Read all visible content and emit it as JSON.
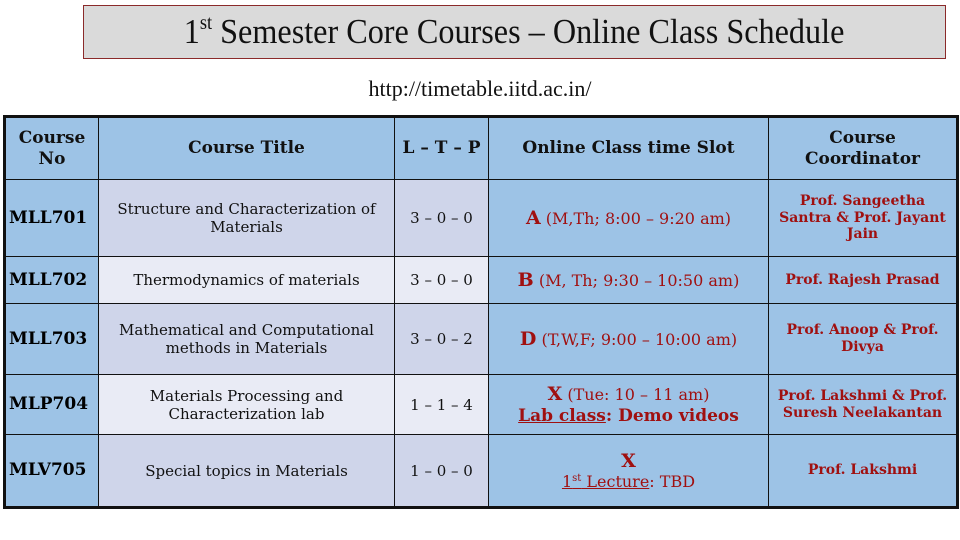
{
  "header": {
    "title_prefix": "1",
    "title_sup": "st",
    "title_main": " Semester Core Courses – Online Class Schedule",
    "url": "http://timetable.iitd.ac.in/"
  },
  "table": {
    "columns": [
      "Course No",
      "Course Title",
      "L – T – P",
      "Online Class time Slot",
      "Course Coordinator"
    ],
    "rows": [
      {
        "course_no": "MLL701",
        "title": "Structure and Characterization of Materials",
        "ltp": "3 – 0 – 0",
        "slot_letter": "A",
        "slot_detail": " (M,Th; 8:00 – 9:20 am)",
        "coordinator": "Prof. Sangeetha Santra & Prof. Jayant Jain"
      },
      {
        "course_no": "MLL702",
        "title": "Thermodynamics of materials",
        "ltp": "3 – 0 – 0",
        "slot_letter": "B",
        "slot_detail": " (M, Th; 9:30 – 10:50 am)",
        "coordinator": "Prof. Rajesh Prasad"
      },
      {
        "course_no": "MLL703",
        "title": "Mathematical and Computational methods in Materials",
        "ltp": "3 – 0 – 2",
        "slot_letter": "D",
        "slot_detail": " (T,W,F; 9:00 – 10:00 am)",
        "coordinator": "Prof. Anoop & Prof. Divya"
      },
      {
        "course_no": "MLP704",
        "title": "Materials Processing and Characterization lab",
        "ltp": "1 – 1 – 4",
        "slot_letter": "X",
        "slot_detail": " (Tue: 10 – 11 am)",
        "slot_note_label": "Lab class",
        "slot_note_sep": ": ",
        "slot_note_value": "Demo videos",
        "coordinator": "Prof. Lakshmi & Prof. Suresh Neelakantan"
      },
      {
        "course_no": "MLV705",
        "title": "Special topics in Materials",
        "ltp": "1 – 0 – 0",
        "slot_letter": "X",
        "slot_note_num": "1",
        "slot_note_sup": "st",
        "slot_note_label": " Lecture",
        "slot_note_sep": ": ",
        "slot_note_value": "TBD",
        "coordinator": "Prof. Lakshmi"
      }
    ]
  },
  "colors": {
    "header_bg": "#9dc3e6",
    "row_odd_bg": "#cfd5ea",
    "row_even_bg": "#e9ebf5",
    "accent_red": "#a01010",
    "title_bg": "#dadada",
    "title_border": "#8b2a2a"
  }
}
